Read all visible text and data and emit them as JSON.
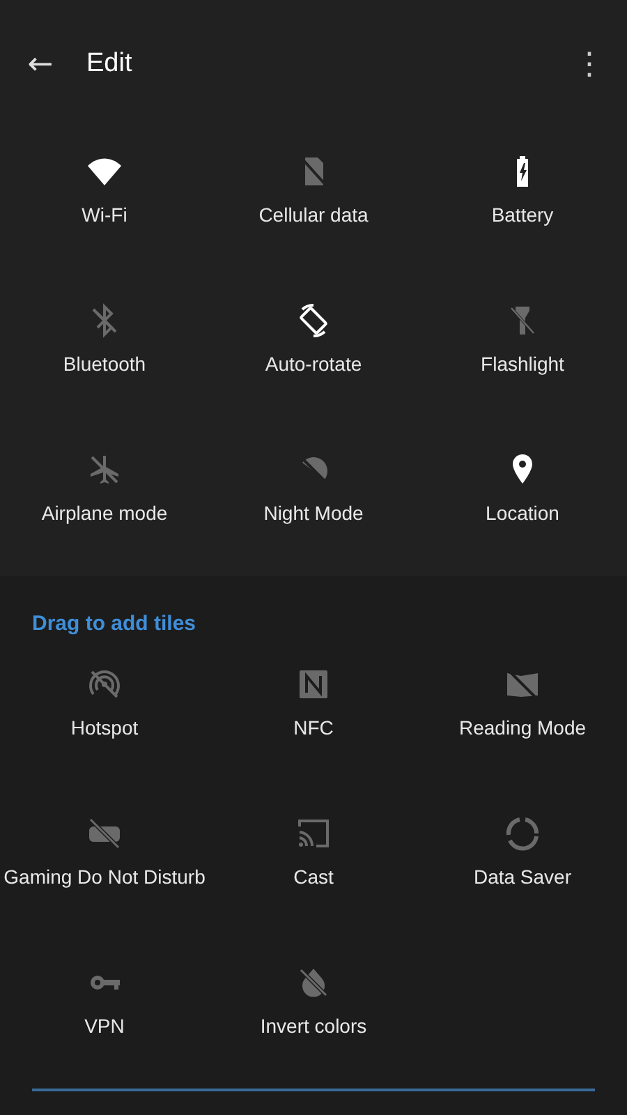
{
  "header": {
    "back": "←",
    "title": "Edit",
    "menu": "⋮"
  },
  "active_tiles": [
    {
      "kind": "wifi",
      "label": "Wi-Fi",
      "on": true
    },
    {
      "kind": "cellular",
      "label": "Cellular data",
      "on": false
    },
    {
      "kind": "battery",
      "label": "Battery",
      "on": true
    },
    {
      "kind": "bluetooth",
      "label": "Bluetooth",
      "on": false
    },
    {
      "kind": "rotate",
      "label": "Auto-rotate",
      "on": true
    },
    {
      "kind": "flashlight",
      "label": "Flashlight",
      "on": false
    },
    {
      "kind": "airplane",
      "label": "Airplane mode",
      "on": false
    },
    {
      "kind": "night",
      "label": "Night Mode",
      "on": false
    },
    {
      "kind": "location",
      "label": "Location",
      "on": true
    }
  ],
  "add_section": {
    "title": "Drag to add tiles"
  },
  "available_tiles": [
    {
      "kind": "hotspot",
      "label": "Hotspot",
      "on": false
    },
    {
      "kind": "nfc",
      "label": "NFC",
      "on": false
    },
    {
      "kind": "reading",
      "label": "Reading Mode",
      "on": false
    },
    {
      "kind": "gaming",
      "label": "Gaming Do Not Disturb",
      "on": false
    },
    {
      "kind": "cast",
      "label": "Cast",
      "on": false
    },
    {
      "kind": "datasaver",
      "label": "Data Saver",
      "on": false
    },
    {
      "kind": "vpn",
      "label": "VPN",
      "on": false
    },
    {
      "kind": "invert",
      "label": "Invert colors",
      "on": false
    }
  ]
}
